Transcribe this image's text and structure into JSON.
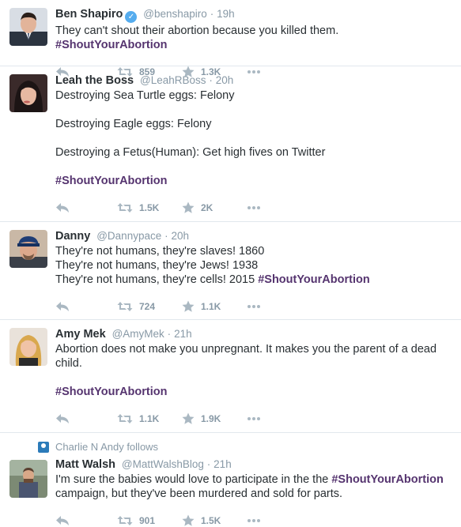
{
  "colors": {
    "hashtag": "#55346f",
    "muted": "#8899a6",
    "icon": "#aab8c2",
    "verified": "#55acee"
  },
  "tweets": [
    {
      "name": "Ben Shapiro",
      "verified": true,
      "handle": "@benshapiro",
      "sep": "·",
      "time": "19h",
      "lines": [
        "They can't shout their abortion because you killed them. ",
        "#ShoutYourAbortion"
      ],
      "retweets": "859",
      "likes": "1.3K"
    },
    {
      "name": "Leah the Boss",
      "handle": "@LeahRBoss",
      "sep": "·",
      "time": "20h",
      "p1": "Destroying Sea Turtle eggs: Felony",
      "p2": "Destroying Eagle eggs: Felony",
      "p3": "Destroying a Fetus(Human): Get high fives on Twitter",
      "hashtag": "#ShoutYourAbortion",
      "retweets": "1.5K",
      "likes": "2K"
    },
    {
      "name": "Danny",
      "handle": "@Dannypace",
      "sep": "·",
      "time": "20h",
      "l1": "They're not humans, they're slaves! 1860",
      "l2": "They're not humans, they're Jews! 1938",
      "l3": "They're not humans, they're cells! 2015 ",
      "hashtag": "#ShoutYourAbortion",
      "retweets": "724",
      "likes": "1.1K"
    },
    {
      "name": "Amy Mek",
      "handle": "@AmyMek",
      "sep": "·",
      "time": "21h",
      "p1": "Abortion does not make you unpregnant. It makes you the parent of a dead child.",
      "hashtag": "#ShoutYourAbortion",
      "retweets": "1.1K",
      "likes": "1.9K"
    },
    {
      "context": "Charlie N Andy follows",
      "name": "Matt Walsh",
      "handle": "@MattWalshBlog",
      "sep": "·",
      "time": "21h",
      "t1": "I'm sure the babies would love to participate in the the ",
      "hashtag": "#ShoutYourAbortion",
      "t2": " campaign, but they've been murdered and sold for parts.",
      "retweets": "901",
      "likes": "1.5K"
    }
  ]
}
